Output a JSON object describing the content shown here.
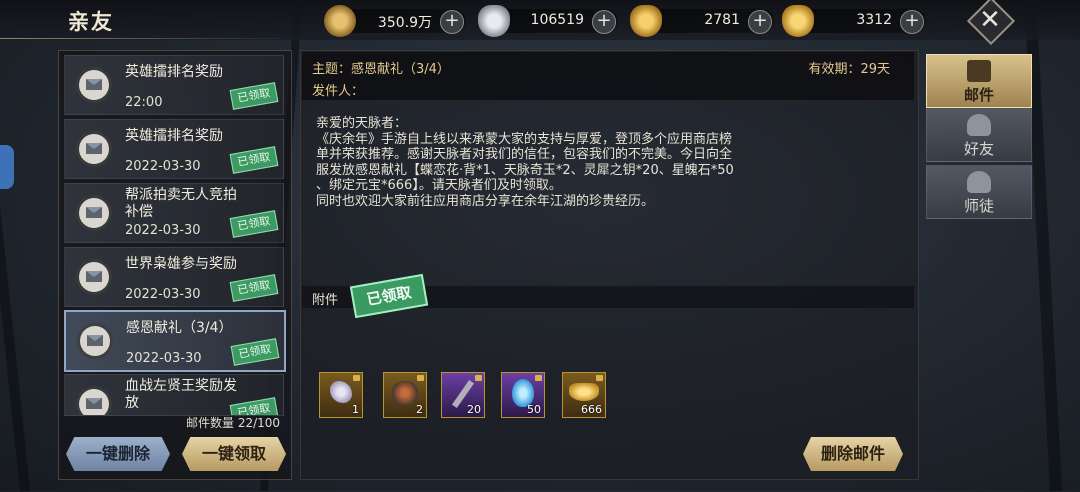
{
  "header": {
    "title": "亲友"
  },
  "currencies": [
    {
      "icon": "coin-icon",
      "value": "350.9万",
      "color": "#c79a3f"
    },
    {
      "icon": "silver-ingot-icon",
      "value": "106519",
      "color": "#c9ccd1"
    },
    {
      "icon": "bound-gold-ingot-icon",
      "value": "2781",
      "color": "#e2a93a"
    },
    {
      "icon": "gold-ingot-icon",
      "value": "3312",
      "color": "#e8b43c"
    }
  ],
  "mail_list": {
    "items": [
      {
        "title": "英雄擂排名奖励",
        "date": "22:00",
        "stamp": "已领取"
      },
      {
        "title": "英雄擂排名奖励",
        "date": "2022-03-30",
        "stamp": "已领取"
      },
      {
        "title": "帮派拍卖无人竞拍补偿",
        "date": "2022-03-30",
        "stamp": "已领取"
      },
      {
        "title": "世界枭雄参与奖励",
        "date": "2022-03-30",
        "stamp": "已领取"
      },
      {
        "title": "感恩献礼（3/4）",
        "date": "2022-03-30",
        "stamp": "已领取",
        "selected": true
      },
      {
        "title": "血战左贤王奖励发放",
        "date": "",
        "stamp": "已领取"
      }
    ],
    "count_label": "邮件数量 22/100",
    "delete_all_label": "一键删除",
    "claim_all_label": "一键领取"
  },
  "detail": {
    "subject": "主题：感恩献礼（3/4）",
    "sender": "发件人：",
    "validity": "有效期：29天",
    "body": "亲爱的天脉者：\n《庆余年》手游自上线以来承蒙大家的支持与厚爱，登顶多个应用商店榜\n单并荣获推荐。感谢天脉者对我们的信任，包容我们的不完美。今日向全\n服发放感恩献礼【蝶恋花·背*1、天脉奇玉*2、灵犀之钥*20、星魄石*50\n、绑定元宝*666】。请天脉者们及时领取。\n同时也欢迎大家前往应用商店分享在余年江湖的珍贵经历。",
    "attachment_label": "附件",
    "attachment_stamp": "已领取",
    "items": [
      {
        "icon": "butterfly-wings-icon",
        "count": "1"
      },
      {
        "icon": "jade-ore-icon",
        "count": "2"
      },
      {
        "icon": "key-icon",
        "count": "20"
      },
      {
        "icon": "crystal-icon",
        "count": "50"
      },
      {
        "icon": "gold-ingot-icon",
        "count": "666"
      }
    ],
    "delete_label": "删除邮件"
  },
  "tabs": [
    {
      "label": "邮件",
      "icon": "mail-icon",
      "active": true
    },
    {
      "label": "好友",
      "icon": "friend-icon",
      "active": false
    },
    {
      "label": "师徒",
      "icon": "mentor-icon",
      "active": false
    }
  ]
}
